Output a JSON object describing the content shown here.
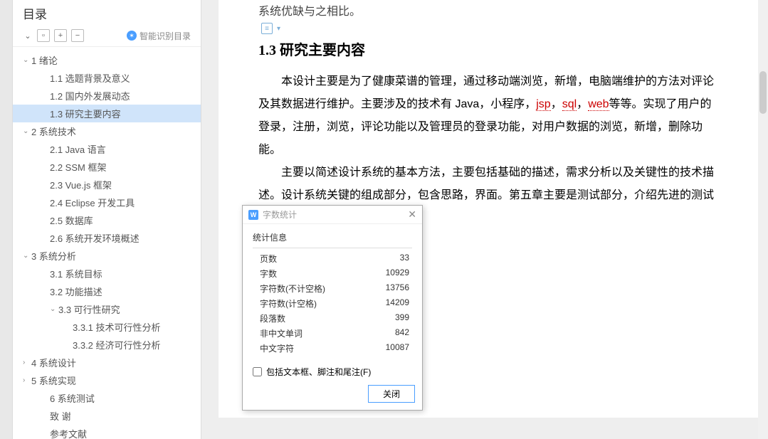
{
  "toc": {
    "title": "目录",
    "smart_label": "智能识别目录",
    "items": [
      {
        "level": 1,
        "chev": "down",
        "label": "1 绪论"
      },
      {
        "level": 2,
        "chev": "none",
        "label": "1.1 选题背景及意义"
      },
      {
        "level": 2,
        "chev": "none",
        "label": "1.2 国内外发展动态"
      },
      {
        "level": 2,
        "chev": "none",
        "label": "1.3 研究主要内容",
        "selected": true
      },
      {
        "level": 1,
        "chev": "down",
        "label": "2 系统技术"
      },
      {
        "level": 2,
        "chev": "none",
        "label": "2.1 Java 语言"
      },
      {
        "level": 2,
        "chev": "none",
        "label": "2.2 SSM 框架"
      },
      {
        "level": 2,
        "chev": "none",
        "label": "2.3 Vue.js 框架"
      },
      {
        "level": 2,
        "chev": "none",
        "label": "2.4 Eclipse 开发工具"
      },
      {
        "level": 2,
        "chev": "none",
        "label": "2.5 数据库"
      },
      {
        "level": 2,
        "chev": "none",
        "label": "2.6 系统开发环境概述"
      },
      {
        "level": 1,
        "chev": "down",
        "label": "3 系统分析"
      },
      {
        "level": 2,
        "chev": "none",
        "label": "3.1 系统目标"
      },
      {
        "level": 2,
        "chev": "none",
        "label": "3.2 功能描述"
      },
      {
        "level": 3,
        "chev": "down",
        "label": "3.3 可行性研究"
      },
      {
        "level": 4,
        "chev": "none",
        "label": "3.3.1 技术可行性分析"
      },
      {
        "level": 4,
        "chev": "none",
        "label": "3.3.2 经济可行性分析"
      },
      {
        "level": 1,
        "chev": "right",
        "label": "4 系统设计"
      },
      {
        "level": 1,
        "chev": "right",
        "label": "5 系统实现"
      },
      {
        "level": 2,
        "chev": "none",
        "label": "6 系统测试"
      },
      {
        "level": 2,
        "chev": "none",
        "label": "致  谢"
      },
      {
        "level": 2,
        "chev": "none",
        "label": "参考文献"
      }
    ]
  },
  "doc": {
    "top_fragment": "系统优缺与之相比。",
    "heading": "1.3 研究主要内容",
    "p1_a": "本设计主要是为了健康菜谱的管理，通过移动端浏览，新增，电脑端维护的方法对评论及其数据进行维护。主要涉及的技术有 Java，小程序，",
    "p1_jsp": "jsp",
    "p1_comma1": "，",
    "p1_sql": "sql",
    "p1_comma2": "，",
    "p1_web": "web",
    "p1_b": "等等。实现了用户的登录，注册，浏览，评论功能以及管理员的登录功能，对用户数据的浏览，新增，删除功能。",
    "p2": "主要以简述设计系统的基本方法，主要包括基础的描述，需求分析以及关键性的技术描述。设计系统关键的组成部分，包含思路，界面。第五章主要是测试部分，介绍先进的测试方法，并客观的阐述系统性能。"
  },
  "dialog": {
    "title": "字数统计",
    "section": "统计信息",
    "stats": [
      {
        "label": "页数",
        "value": "33"
      },
      {
        "label": "字数",
        "value": "10929"
      },
      {
        "label": "字符数(不计空格)",
        "value": "13756"
      },
      {
        "label": "字符数(计空格)",
        "value": "14209"
      },
      {
        "label": "段落数",
        "value": "399"
      },
      {
        "label": "非中文单词",
        "value": "842"
      },
      {
        "label": "中文字符",
        "value": "10087"
      }
    ],
    "checkbox_label": "包括文本框、脚注和尾注(F)",
    "close_btn": "关闭"
  }
}
